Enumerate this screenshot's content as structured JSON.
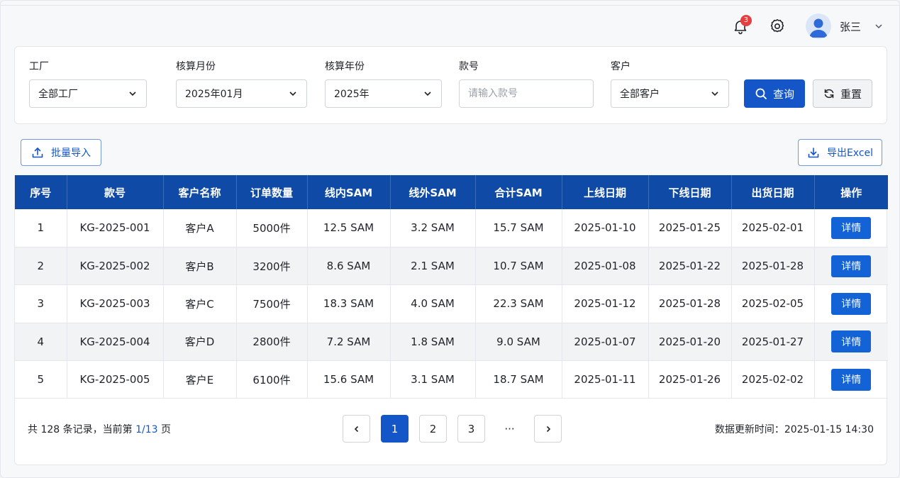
{
  "header": {
    "notification_count": "3",
    "user_name": "张三"
  },
  "filters": {
    "factory": {
      "label": "工厂",
      "value": "全部工厂"
    },
    "month": {
      "label": "核算月份",
      "value": "2025年01月"
    },
    "year": {
      "label": "核算年份",
      "value": "2025年"
    },
    "style": {
      "label": "款号",
      "value": "",
      "placeholder": "请输入款号"
    },
    "customer": {
      "label": "客户",
      "value": "全部客户"
    },
    "query_label": "查询",
    "reset_label": "重置"
  },
  "toolbar": {
    "import_label": "批量导入",
    "export_label": "导出Excel"
  },
  "table": {
    "columns": [
      "序号",
      "款号",
      "客户名称",
      "订单数量",
      "线内SAM",
      "线外SAM",
      "合计SAM",
      "上线日期",
      "下线日期",
      "出货日期",
      "操作"
    ],
    "action_label": "详情",
    "rows": [
      [
        "1",
        "KG-2025-001",
        "客户A",
        "5000件",
        "12.5 SAM",
        "3.2 SAM",
        "15.7 SAM",
        "2025-01-10",
        "2025-01-25",
        "2025-02-01"
      ],
      [
        "2",
        "KG-2025-002",
        "客户B",
        "3200件",
        "8.6 SAM",
        "2.1 SAM",
        "10.7 SAM",
        "2025-01-08",
        "2025-01-22",
        "2025-01-28"
      ],
      [
        "3",
        "KG-2025-003",
        "客户C",
        "7500件",
        "18.3 SAM",
        "4.0 SAM",
        "22.3 SAM",
        "2025-01-12",
        "2025-01-28",
        "2025-02-05"
      ],
      [
        "4",
        "KG-2025-004",
        "客户D",
        "2800件",
        "7.2 SAM",
        "1.8 SAM",
        "9.0 SAM",
        "2025-01-07",
        "2025-01-20",
        "2025-01-27"
      ],
      [
        "5",
        "KG-2025-005",
        "客户E",
        "6100件",
        "15.6 SAM",
        "3.1 SAM",
        "18.7 SAM",
        "2025-01-11",
        "2025-01-26",
        "2025-02-02"
      ]
    ]
  },
  "pagination": {
    "summary_prefix": "共 128 条记录，当前第 ",
    "current": "1/13",
    "summary_suffix": " 页",
    "pages": [
      "1",
      "2",
      "3"
    ],
    "ellipsis": "···",
    "update_text": "数据更新时间：2025-01-15 14:30"
  },
  "colors": {
    "primary": "#1456c8",
    "table_header": "#0f4ba6",
    "badge": "#e53e3e"
  }
}
